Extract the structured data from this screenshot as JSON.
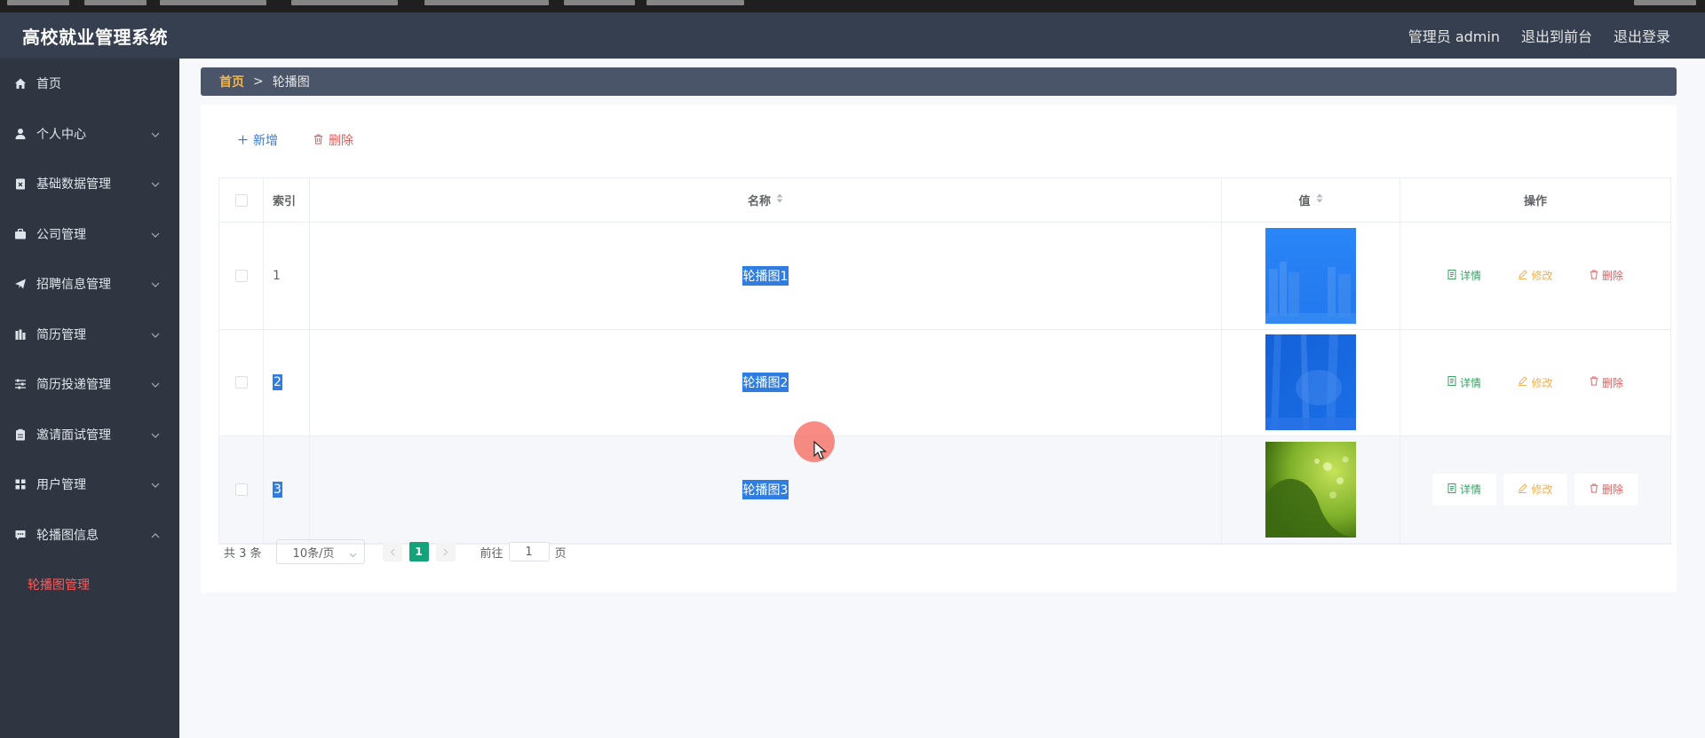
{
  "app": {
    "title": "高校就业管理系统"
  },
  "header": {
    "user_label": "管理员 admin",
    "front_link": "退出到前台",
    "logout_link": "退出登录"
  },
  "sidebar": {
    "items": [
      {
        "label": "首页",
        "icon": "home-icon",
        "expandable": false
      },
      {
        "label": "个人中心",
        "icon": "user-icon",
        "expandable": true
      },
      {
        "label": "基础数据管理",
        "icon": "clipboard-x-icon",
        "expandable": true
      },
      {
        "label": "公司管理",
        "icon": "briefcase-icon",
        "expandable": true
      },
      {
        "label": "招聘信息管理",
        "icon": "paper-plane-icon",
        "expandable": true
      },
      {
        "label": "简历管理",
        "icon": "bar-chart-icon",
        "expandable": true
      },
      {
        "label": "简历投递管理",
        "icon": "sliders-icon",
        "expandable": true
      },
      {
        "label": "邀请面试管理",
        "icon": "clipboard-icon",
        "expandable": true
      },
      {
        "label": "用户管理",
        "icon": "grid-icon",
        "expandable": true
      },
      {
        "label": "轮播图信息",
        "icon": "chat-icon",
        "expandable": true,
        "expanded": true
      }
    ],
    "sub_items": [
      {
        "label": "轮播图管理",
        "active": true
      }
    ]
  },
  "breadcrumb": {
    "home": "首页",
    "separator": ">",
    "current": "轮播图"
  },
  "toolbar": {
    "add_label": "新增",
    "delete_label": "删除"
  },
  "table": {
    "columns": {
      "index": "索引",
      "name": "名称",
      "value": "值",
      "actions": "操作"
    },
    "rows": [
      {
        "index": "1",
        "name": "轮播图1",
        "thumb": "blue-city"
      },
      {
        "index": "2",
        "name": "轮播图2",
        "thumb": "blue-abstract"
      },
      {
        "index": "3",
        "name": "轮播图3",
        "thumb": "green-drops"
      }
    ],
    "actions": {
      "detail": "详情",
      "edit": "修改",
      "delete": "删除"
    }
  },
  "pagination": {
    "total": "共 3 条",
    "page_size": "10条/页",
    "current_page": "1",
    "goto_label": "前往",
    "goto_value": "1",
    "page_suffix": "页"
  },
  "colors": {
    "topbar": "#353f4f",
    "sidebar": "#2f3641",
    "breadcrumb": "#4a556a",
    "accent_orange": "#f2b54a",
    "active_red": "#ff5a5a",
    "pager_green": "#15a27a",
    "selection_blue": "#2f7de1"
  }
}
